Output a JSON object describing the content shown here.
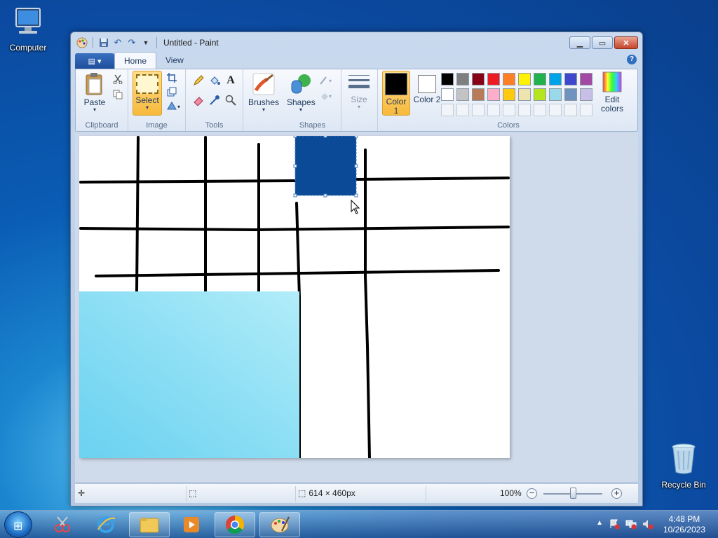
{
  "desktop": {
    "icons": [
      {
        "label": "Computer"
      },
      {
        "label": "Recycle Bin"
      }
    ]
  },
  "window": {
    "title": "Untitled - Paint",
    "tabs": [
      {
        "label": "Home"
      },
      {
        "label": "View"
      }
    ],
    "groups": {
      "clipboard": {
        "label": "Clipboard",
        "paste": "Paste"
      },
      "image": {
        "label": "Image",
        "select": "Select"
      },
      "tools": {
        "label": "Tools"
      },
      "brushes": {
        "label": "Brushes"
      },
      "shapes": {
        "label": "Shapes",
        "shapes_btn": "Shapes"
      },
      "size": {
        "label": "Size"
      },
      "colors": {
        "label": "Colors",
        "color1": "Color 1",
        "color2": "Color 2",
        "edit": "Edit colors",
        "color1_value": "#000000",
        "color2_value": "#ffffff",
        "palette": [
          "#000000",
          "#7f7f7f",
          "#880015",
          "#ed1c24",
          "#ff7f27",
          "#fff200",
          "#22b14c",
          "#00a2e8",
          "#3f48cc",
          "#a349a4",
          "#ffffff",
          "#c3c3c3",
          "#b97a57",
          "#ffaec9",
          "#ffc90e",
          "#efe4b0",
          "#b5e61d",
          "#99d9ea",
          "#7092be",
          "#c8bfe7"
        ]
      }
    },
    "canvas": {
      "selection_fill": "#0b4a96",
      "sky_fill": "#7fdcf4"
    },
    "status": {
      "image_size": "614 × 460px",
      "zoom": "100%",
      "zoom_level": 100
    }
  },
  "taskbar": {
    "clock_time": "4:48 PM",
    "clock_date": "10/26/2023"
  }
}
